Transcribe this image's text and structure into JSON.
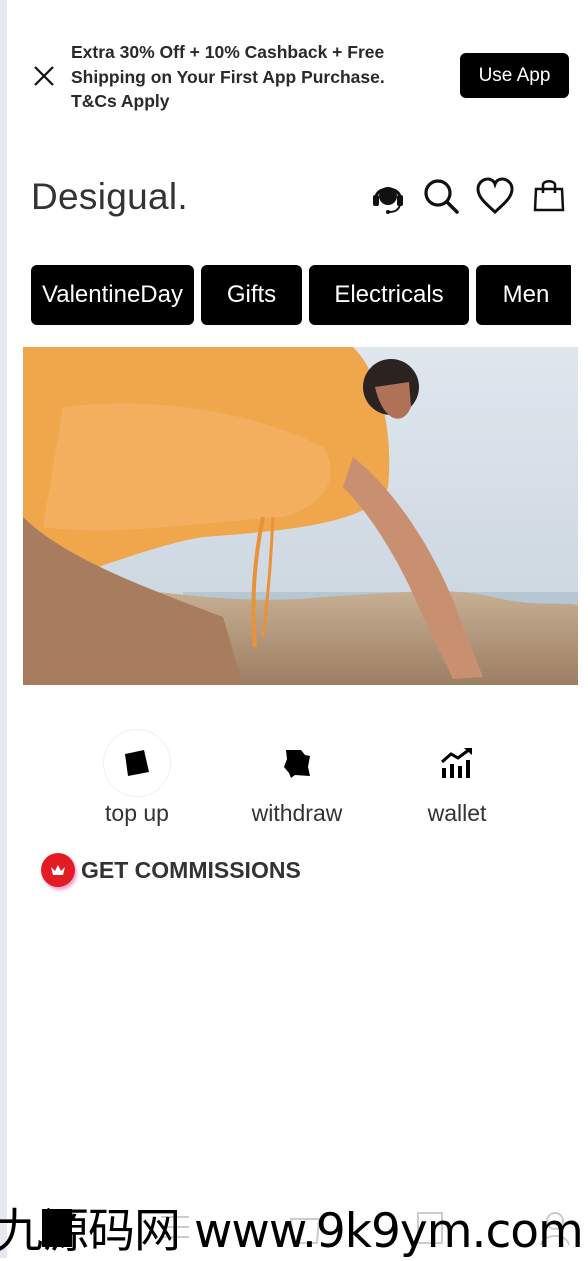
{
  "promo": {
    "line1": "Extra 30% Off + 10% Cashback + Free",
    "line2": "Shipping on Your First App Purchase.",
    "line3": "T&Cs Apply",
    "cta": "Use App"
  },
  "header": {
    "brand": "Desigual.",
    "icons": [
      "headset-icon",
      "search-icon",
      "heart-icon",
      "bag-icon"
    ]
  },
  "categories": [
    "ValentineDay",
    "Gifts",
    "Electricals",
    "Men"
  ],
  "actions": [
    {
      "label": "top up",
      "icon": "wallet-card-icon"
    },
    {
      "label": "withdraw",
      "icon": "withdraw-icon"
    },
    {
      "label": "wallet",
      "icon": "chart-up-icon"
    }
  ],
  "commission": {
    "label": "GET COMMISSIONS",
    "icon": "crown-icon"
  },
  "watermark": "九源码网 www.9k9ym.com"
}
